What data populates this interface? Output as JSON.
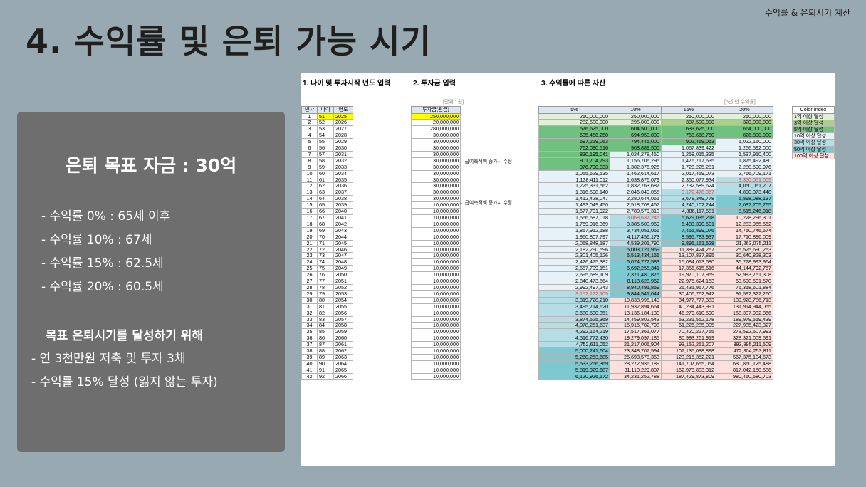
{
  "header": {
    "topright": "수익률 & 은퇴시기 계산",
    "title": "4. 수익률 및 은퇴 가능 시기"
  },
  "panel": {
    "goal": "은퇴 목표 자금 : 30억",
    "rates": [
      "- 수익률 0% : 65세 이후",
      "- 수익률 10% : 67세",
      "- 수익률 15% : 62.5세",
      "- 수익률 20% : 60.5세"
    ],
    "subtitle": "목표 은퇴시기를 달성하기 위해",
    "tips": [
      "- 연 3천만원 저축 및 투자 3채",
      "- 수익률 15% 달성 (잃지 않는 투자)"
    ]
  },
  "sheet": {
    "sec1": "1. 나이 및 투자시작 년도 입력",
    "sec2": "2. 투자금 입력",
    "sec3": "3. 수익률에 따른 자산",
    "unit_note": "[단위 : 원]",
    "rate_note": "[5년 년 수익률]",
    "headers1": [
      "년차",
      "나이",
      "연도"
    ],
    "headers2": [
      "투자금(원금)"
    ],
    "headers3": [
      "5%",
      "10%",
      "15%",
      "20%"
    ],
    "note": "← 급여축적액 증가시 수정",
    "years": [
      1,
      2,
      3,
      4,
      5,
      6,
      7,
      8,
      9,
      10,
      11,
      12,
      13,
      14,
      15,
      16,
      17,
      18,
      19,
      20,
      21,
      22,
      23,
      24,
      25,
      26,
      27,
      28,
      29,
      30,
      31,
      32,
      33,
      34,
      35,
      36,
      37,
      38,
      39,
      40,
      41,
      42
    ],
    "ages": [
      51,
      52,
      53,
      54,
      55,
      56,
      57,
      58,
      59,
      60,
      61,
      62,
      63,
      64,
      65,
      66,
      67,
      68,
      69,
      70,
      71,
      72,
      73,
      74,
      75,
      76,
      77,
      78,
      79,
      80,
      81,
      82,
      83,
      84,
      85,
      86,
      87,
      88,
      89,
      90,
      91,
      92
    ],
    "calendar": [
      2025,
      2026,
      2027,
      2028,
      2029,
      2030,
      2031,
      2032,
      2033,
      2034,
      2035,
      2036,
      2037,
      2038,
      2039,
      2040,
      2041,
      2042,
      2043,
      2044,
      2045,
      2046,
      2047,
      2048,
      2049,
      2050,
      2051,
      2052,
      2053,
      2054,
      2055,
      2056,
      2057,
      2058,
      2059,
      2060,
      2061,
      2062,
      2063,
      2064,
      2065,
      2066
    ],
    "invest": [
      "250,000,000",
      "20,000,000",
      "280,000,000",
      "30,000,000",
      "30,000,000",
      "30,000,000",
      "30,000,000",
      "30,000,000",
      "30,000,000",
      "30,000,000",
      "30,000,000",
      "30,000,000",
      "30,000,000",
      "30,000,000",
      "10,000,000",
      "10,000,000",
      "10,000,000",
      "10,000,000",
      "10,000,000",
      "10,000,000",
      "10,000,000",
      "10,000,000",
      "10,000,000",
      "10,000,000",
      "10,000,000",
      "10,000,000",
      "10,000,000",
      "10,000,000",
      "10,000,000",
      "10,000,000",
      "10,000,000",
      "10,000,000",
      "10,000,000",
      "10,000,000",
      "10,000,000",
      "10,000,000",
      "10,000,000",
      "10,000,000",
      "10,000,000",
      "10,000,000",
      "10,000,000",
      "10,000,000"
    ],
    "r5": [
      "250,000,000",
      "282,500,000",
      "576,625,000",
      "635,456,250",
      "697,229,063",
      "762,090,516",
      "830,195,041",
      "901,704,793",
      "976,790,033",
      "1,055,629,535",
      "1,138,411,012",
      "1,225,331,562",
      "1,316,598,140",
      "1,412,428,047",
      "1,493,049,450",
      "1,577,701,922",
      "1,666,587,018",
      "1,759,916,369",
      "1,857,912,188",
      "1,960,807,797",
      "2,068,848,187",
      "2,182,290,596",
      "2,301,405,126",
      "2,426,475,382",
      "2,557,799,151",
      "2,695,689,109",
      "2,840,473,564",
      "2,992,497,243",
      "3,152,122,105",
      "3,319,728,210",
      "3,495,714,620",
      "3,680,500,351",
      "3,874,525,369",
      "4,078,251,637",
      "4,292,164,219",
      "4,516,772,430",
      "4,752,611,052",
      "5,000,241,604",
      "5,260,253,685",
      "5,533,266,369",
      "5,819,929,687",
      "6,120,926,172"
    ],
    "r10": [
      "250,000,000",
      "295,000,000",
      "604,500,000",
      "694,950,000",
      "794,445,000",
      "903,889,500",
      "1,024,278,450",
      "1,156,706,295",
      "1,302,376,925",
      "1,462,614,617",
      "1,638,876,079",
      "1,832,763,687",
      "2,046,040,055",
      "2,280,644,061",
      "2,518,708,467",
      "2,780,579,313",
      "3,068,637,245",
      "3,385,500,969",
      "3,734,051,066",
      "4,117,456,173",
      "4,539,201,790",
      "5,003,121,969",
      "5,513,434,166",
      "6,074,777,583",
      "6,692,255,341",
      "7,371,480,875",
      "8,118,628,962",
      "8,940,491,859",
      "9,844,541,044",
      "10,838,995,149",
      "11,932,894,664",
      "13,136,184,130",
      "14,459,802,543",
      "15,915,782,798",
      "17,517,361,077",
      "19,279,097,185",
      "21,217,006,904",
      "23,348,707,594",
      "25,693,578,353",
      "28,272,936,189",
      "31,110,229,807",
      "34,231,252,788"
    ],
    "r15": [
      "250,000,000",
      "307,500,000",
      "633,625,000",
      "758,668,750",
      "902,469,063",
      "1,067,839,422",
      "1,258,015,335",
      "1,476,717,635",
      "1,728,225,281",
      "2,017,459,073",
      "2,350,077,934",
      "2,732,589,624",
      "3,172,478,067",
      "3,678,349,778",
      "4,240,102,244",
      "4,886,117,581",
      "5,629,035,218",
      "6,483,390,501",
      "7,465,899,076",
      "8,595,783,937",
      "9,895,151,528",
      "11,389,424,257",
      "13,107,837,895",
      "15,084,013,580",
      "17,356,615,616",
      "19,970,107,959",
      "22,975,624,153",
      "26,431,967,776",
      "30,406,762,942",
      "34,977,777,383",
      "40,234,443,991",
      "46,279,610,590",
      "53,231,552,178",
      "61,226,285,005",
      "70,420,227,755",
      "80,993,261,919",
      "93,152,251,207",
      "107,135,088,888",
      "123,215,352,221",
      "141,707,655,054",
      "162,973,803,312",
      "187,429,873,809"
    ],
    "r20": [
      "250,000,000",
      "320,000,000",
      "664,000,000",
      "826,800,000",
      "1,022,160,000",
      "1,256,592,000",
      "1,537,910,400",
      "1,875,492,480",
      "2,280,590,976",
      "2,766,709,171",
      "3,350,051,005",
      "4,050,061,207",
      "4,890,073,448",
      "5,898,088,137",
      "7,087,705,765",
      "8,515,246,918",
      "10,228,296,301",
      "12,283,955,562",
      "14,750,746,674",
      "17,710,896,009",
      "21,263,075,211",
      "25,525,690,253",
      "30,640,828,303",
      "36,778,993,964",
      "44,144,792,757",
      "52,983,751,308",
      "63,590,501,570",
      "76,318,601,884",
      "91,592,322,260",
      "109,920,786,713",
      "131,914,944,055",
      "158,307,932,866",
      "189,979,519,439",
      "227,985,423,327",
      "273,592,507,993",
      "328,321,009,591",
      "393,995,211,509",
      "472,804,253,811",
      "567,375,104,573",
      "680,860,125,488",
      "817,042,150,586",
      "980,460,580,703"
    ],
    "legend_title": "Color Index",
    "legend": [
      "1억 이상 달성",
      "3억 이상 달성",
      "5억 이상 달성",
      "10억 이상 달성",
      "30억 이상 달성",
      "50억 이상 달성",
      "100억 이상 달성"
    ]
  },
  "colors": {
    "yellow": "#ffff00",
    "g1": "#e2f0d9",
    "g2": "#a9d08e",
    "g3": "#70c080",
    "g4": "#e7f2f8",
    "g5": "#b4dde6",
    "g6": "#7ec8cf",
    "g7": "#fde0dc",
    "red": "#e03b3b"
  }
}
